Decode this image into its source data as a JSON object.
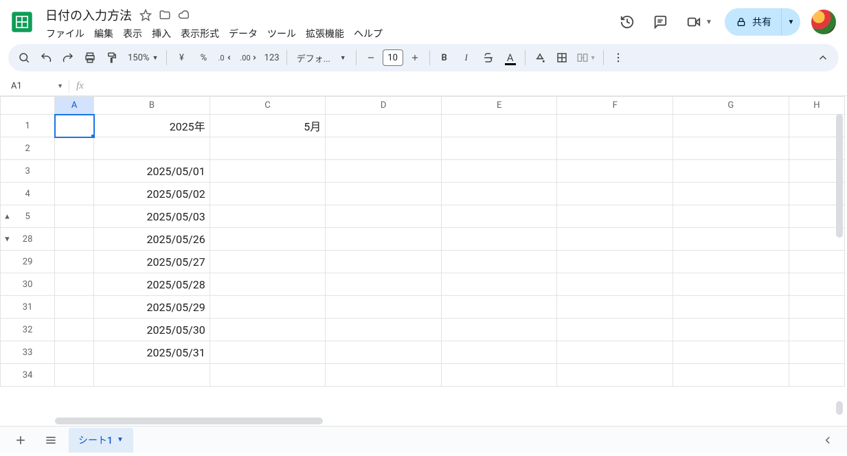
{
  "doc": {
    "title": "日付の入力方法"
  },
  "menus": {
    "file": "ファイル",
    "edit": "編集",
    "view": "表示",
    "insert": "挿入",
    "format": "表示形式",
    "data": "データ",
    "tools": "ツール",
    "extensions": "拡張機能",
    "help": "ヘルプ"
  },
  "toolbar": {
    "zoom": "150%",
    "currency": "¥",
    "percent": "%",
    "dec_dec": ".0",
    "dec_inc": ".00",
    "num_fmt": "123",
    "font": "デフォ...",
    "font_size": "10",
    "bold": "B",
    "italic": "I",
    "textcolor_letter": "A"
  },
  "share": {
    "label": "共有"
  },
  "namebox": {
    "ref": "A1"
  },
  "formula": {
    "fx": "fx",
    "value": ""
  },
  "columns": [
    "A",
    "B",
    "C",
    "D",
    "E",
    "F",
    "G",
    "H"
  ],
  "rows": [
    {
      "num": "1",
      "A": "",
      "B": "2025年",
      "C": "5月",
      "selected": true
    },
    {
      "num": "2",
      "A": "",
      "B": "",
      "C": ""
    },
    {
      "num": "3",
      "A": "",
      "B": "2025/05/01",
      "C": ""
    },
    {
      "num": "4",
      "A": "",
      "B": "2025/05/02",
      "C": ""
    },
    {
      "num": "5",
      "A": "",
      "B": "2025/05/03",
      "C": "",
      "group": "up"
    },
    {
      "num": "28",
      "A": "",
      "B": "2025/05/26",
      "C": "",
      "group": "down"
    },
    {
      "num": "29",
      "A": "",
      "B": "2025/05/27",
      "C": ""
    },
    {
      "num": "30",
      "A": "",
      "B": "2025/05/28",
      "C": ""
    },
    {
      "num": "31",
      "A": "",
      "B": "2025/05/29",
      "C": ""
    },
    {
      "num": "32",
      "A": "",
      "B": "2025/05/30",
      "C": ""
    },
    {
      "num": "33",
      "A": "",
      "B": "2025/05/31",
      "C": ""
    },
    {
      "num": "34",
      "A": "",
      "B": "",
      "C": ""
    }
  ],
  "sheet": {
    "tab1": "シート1"
  }
}
